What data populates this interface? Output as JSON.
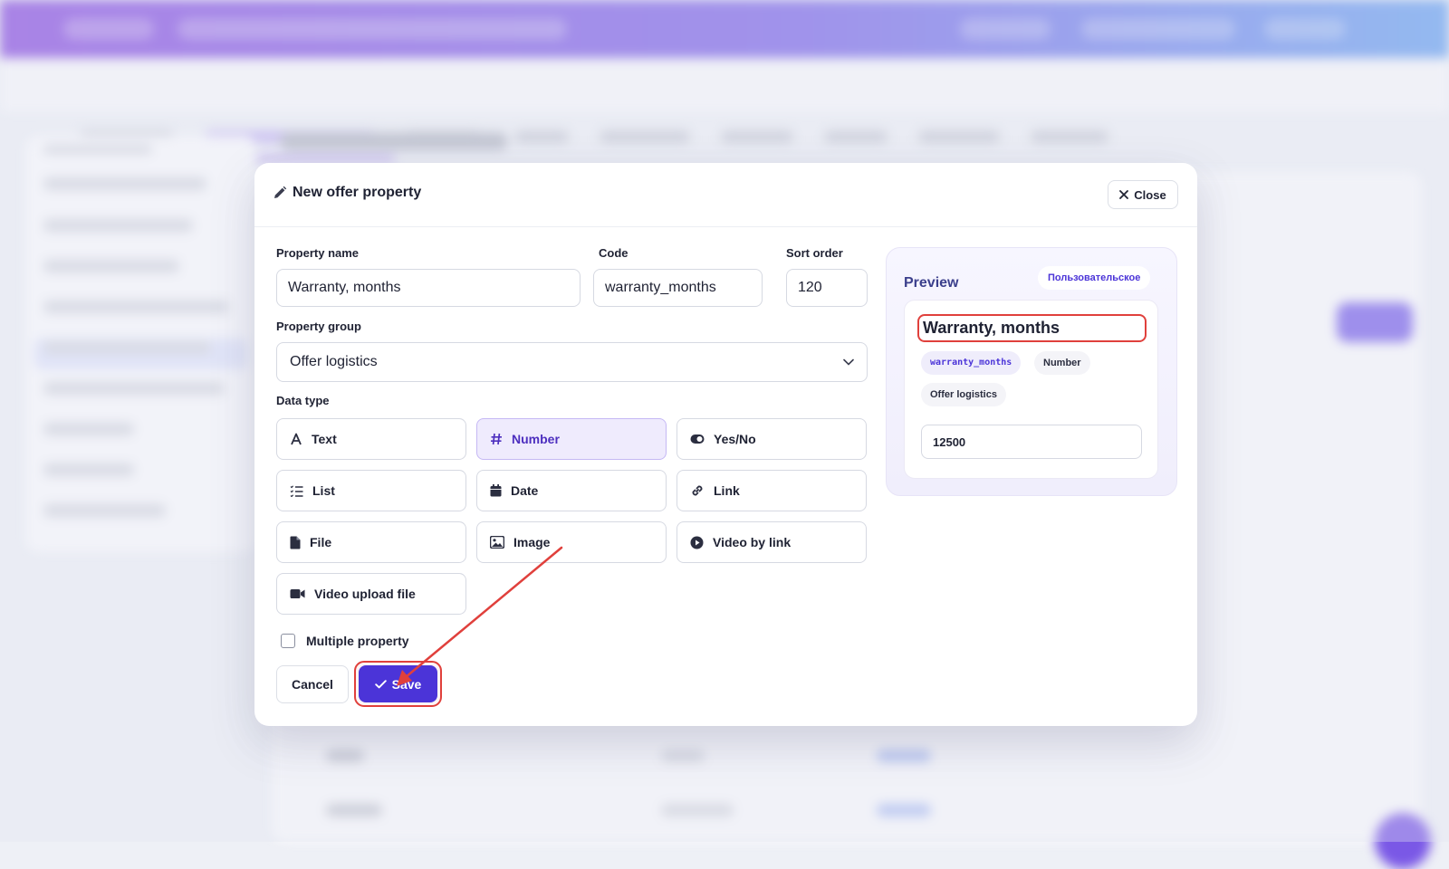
{
  "modal": {
    "title": "New offer property",
    "close_label": "Close",
    "fields": {
      "property_name": {
        "label": "Property name",
        "value": "Warranty, months"
      },
      "code": {
        "label": "Code",
        "value": "warranty_months"
      },
      "sort_order": {
        "label": "Sort order",
        "value": "120"
      }
    },
    "property_group": {
      "label": "Property group",
      "selected": "Offer logistics"
    },
    "data_type": {
      "label": "Data type",
      "options": [
        {
          "label": "Text",
          "icon": "text-icon",
          "active": false
        },
        {
          "label": "Number",
          "icon": "hash-icon",
          "active": true
        },
        {
          "label": "Yes/No",
          "icon": "toggle-icon",
          "active": false
        },
        {
          "label": "List",
          "icon": "list-icon",
          "active": false
        },
        {
          "label": "Date",
          "icon": "calendar-icon",
          "active": false
        },
        {
          "label": "Link",
          "icon": "link-icon",
          "active": false
        },
        {
          "label": "File",
          "icon": "file-icon",
          "active": false
        },
        {
          "label": "Image",
          "icon": "image-icon",
          "active": false
        },
        {
          "label": "Video by link",
          "icon": "play-icon",
          "active": false
        },
        {
          "label": "Video upload file",
          "icon": "video-camera-icon",
          "active": false
        }
      ]
    },
    "multiple_property": {
      "label": "Multiple property",
      "checked": false
    },
    "cancel_label": "Cancel",
    "save_label": "Save"
  },
  "preview": {
    "title": "Preview",
    "badge": "Пользовательское",
    "name": "Warranty, months",
    "chips": {
      "code": "warranty_months",
      "type": "Number",
      "group": "Offer logistics"
    },
    "sample_value": "12500"
  },
  "colors": {
    "accent": "#4b34d8",
    "active_option_bg": "#efebfd",
    "annotation": "#e0403c",
    "header_gradient_start": "#8a4fe0",
    "header_gradient_end": "#6aa2f0"
  }
}
